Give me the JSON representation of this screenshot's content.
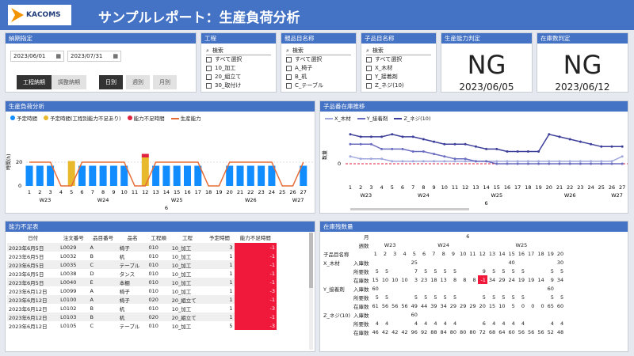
{
  "header": {
    "title": "サンプルレポート：生産負荷分析",
    "logo": "KACOMS"
  },
  "dateFilter": {
    "label": "納期指定",
    "from": "2023/06/01",
    "to": "2023/07/31",
    "buttons": [
      "工程納期",
      "調整納期"
    ],
    "gran": [
      "日別",
      "週別",
      "月別"
    ]
  },
  "slicers": [
    {
      "label": "工程",
      "search": "検索",
      "items": [
        "すべて選択",
        "10_加工",
        "20_組立て",
        "30_取付け"
      ]
    },
    {
      "label": "親品目名称",
      "search": "検索",
      "items": [
        "すべて選択",
        "A_椅子",
        "B_机",
        "C_テーブル"
      ]
    },
    {
      "label": "子品目名称",
      "search": "検索",
      "items": [
        "すべて選択",
        "X_木材",
        "Y_接着剤",
        "Z_ネジ(10)"
      ]
    }
  ],
  "cards": [
    {
      "label": "生産能力判定",
      "value": "NG",
      "date": "2023/06/05"
    },
    {
      "label": "在庫数判定",
      "value": "NG",
      "date": "2023/06/12"
    }
  ],
  "loadChart": {
    "label": "生産負荷分析",
    "legend": [
      "予定時間",
      "予定時間(工程別能力不足あり)",
      "能力不足時間",
      "生産能力"
    ],
    "ylabel": "時間(h)",
    "weeks": [
      "W23",
      "W24",
      "W25",
      "W26",
      "W27"
    ],
    "month": "6"
  },
  "chart_data": [
    {
      "type": "bar",
      "title": "生産負荷分析",
      "x": [
        "1",
        "2",
        "3",
        "4",
        "5",
        "6",
        "7",
        "8",
        "9",
        "10",
        "11",
        "12",
        "13",
        "14",
        "15",
        "16",
        "17",
        "18",
        "19",
        "20",
        "21",
        "22",
        "23",
        "24",
        "25",
        "26",
        "27"
      ],
      "series": [
        {
          "name": "予定時間",
          "values": [
            17,
            17,
            17,
            0,
            0,
            17,
            17,
            17,
            17,
            17,
            0,
            0,
            17,
            17,
            17,
            17,
            17,
            0,
            0,
            17,
            17,
            17,
            17,
            17,
            0,
            0,
            17
          ]
        },
        {
          "name": "予定時間(工程別能力不足あり)",
          "values": [
            0,
            0,
            0,
            0,
            21,
            0,
            0,
            0,
            0,
            0,
            0,
            24,
            0,
            0,
            0,
            0,
            0,
            0,
            0,
            0,
            0,
            0,
            0,
            0,
            0,
            0,
            0
          ]
        },
        {
          "name": "能力不足時間",
          "values": [
            0,
            0,
            0,
            0,
            0,
            0,
            0,
            0,
            0,
            0,
            0,
            3,
            0,
            0,
            0,
            0,
            0,
            0,
            0,
            0,
            0,
            0,
            0,
            0,
            0,
            0,
            0
          ]
        },
        {
          "name": "生産能力",
          "values": [
            20,
            20,
            20,
            0,
            0,
            20,
            20,
            20,
            20,
            20,
            0,
            0,
            20,
            20,
            20,
            20,
            20,
            0,
            0,
            20,
            20,
            20,
            20,
            20,
            0,
            0,
            20
          ]
        }
      ],
      "yticks": [
        "0",
        "20"
      ],
      "ylabel": "時間(h)"
    },
    {
      "type": "line",
      "title": "子品番在庫推移",
      "x": [
        "1",
        "2",
        "3",
        "4",
        "5",
        "6",
        "7",
        "8",
        "9",
        "10",
        "11",
        "12",
        "13",
        "14",
        "15",
        "16",
        "17",
        "18",
        "19",
        "20",
        "21",
        "22",
        "23",
        "24",
        "25",
        "26",
        "27"
      ],
      "series": [
        {
          "name": "X_木材",
          "values": [
            15,
            10,
            10,
            10,
            5,
            5,
            5,
            5,
            5,
            5,
            5,
            5,
            5,
            5,
            5,
            5,
            5,
            5,
            5,
            5,
            5,
            5,
            5,
            5,
            5,
            5,
            15
          ]
        },
        {
          "name": "Y_接着剤",
          "values": [
            40,
            40,
            40,
            30,
            30,
            30,
            25,
            25,
            20,
            15,
            10,
            10,
            5,
            5,
            0,
            0,
            0,
            0,
            0,
            0,
            0,
            0,
            0,
            0,
            0,
            0,
            0
          ]
        },
        {
          "name": "Z_ネジ(10)",
          "values": [
            60,
            55,
            55,
            55,
            60,
            55,
            55,
            50,
            45,
            40,
            40,
            40,
            35,
            30,
            30,
            25,
            25,
            25,
            25,
            60,
            55,
            50,
            45,
            40,
            35,
            35,
            35
          ]
        }
      ],
      "ylabel": "数量",
      "yticks": [
        "0"
      ]
    }
  ],
  "stockChart": {
    "label": "子品番在庫推移",
    "legend": [
      "X_木材",
      "Y_接着剤",
      "Z_ネジ(10)"
    ],
    "weeks": [
      "W23",
      "W24",
      "W25",
      "W26",
      "W27"
    ],
    "month": "6",
    "ylabel": "数量"
  },
  "shortTable": {
    "label": "能力不足表",
    "headers": [
      "日付",
      "注文番号",
      "品目番号",
      "品名",
      "工程順",
      "工程",
      "予定時間",
      "能力不足時間"
    ],
    "rows": [
      [
        "2023年6月5日",
        "L0029",
        "A",
        "椅子",
        "010",
        "10_加工",
        "3",
        "-1"
      ],
      [
        "2023年6月5日",
        "L0032",
        "B",
        "机",
        "010",
        "10_加工",
        "1",
        "-1"
      ],
      [
        "2023年6月5日",
        "L0035",
        "C",
        "テーブル",
        "010",
        "10_加工",
        "1",
        "-1"
      ],
      [
        "2023年6月5日",
        "L0038",
        "D",
        "タンス",
        "010",
        "10_加工",
        "1",
        "-1"
      ],
      [
        "2023年6月5日",
        "L0040",
        "E",
        "本棚",
        "010",
        "10_加工",
        "1",
        "-1"
      ],
      [
        "2023年6月12日",
        "L0099",
        "A",
        "椅子",
        "010",
        "10_加工",
        "1",
        "-3"
      ],
      [
        "2023年6月12日",
        "L0100",
        "A",
        "椅子",
        "020",
        "20_組立て",
        "1",
        "-1"
      ],
      [
        "2023年6月12日",
        "L0102",
        "B",
        "机",
        "010",
        "10_加工",
        "1",
        "-3"
      ],
      [
        "2023年6月12日",
        "L0103",
        "B",
        "机",
        "020",
        "20_組立て",
        "1",
        "-1"
      ],
      [
        "2023年6月12日",
        "L0105",
        "C",
        "テーブル",
        "010",
        "10_加工",
        "5",
        "-3"
      ]
    ]
  },
  "stockTable": {
    "label": "在庫残数量",
    "h1": "月",
    "h2": "週数",
    "h3": "子品目名称",
    "month": "6",
    "weeks": [
      "W23",
      "W24",
      "W25"
    ],
    "days": [
      "1",
      "2",
      "3",
      "4",
      "5",
      "6",
      "7",
      "8",
      "9",
      "10",
      "11",
      "12",
      "13",
      "14",
      "15",
      "16",
      "17",
      "18",
      "19",
      "20"
    ],
    "rows": [
      {
        "item": "X_木材",
        "type": "入庫数",
        "vals": [
          "",
          "",
          "",
          "",
          "25",
          "",
          "",
          "",
          "",
          "",
          "",
          "",
          "",
          "",
          "40",
          "",
          "",
          "",
          "",
          "30"
        ]
      },
      {
        "item": "",
        "type": "所要数",
        "vals": [
          "5",
          "5",
          "",
          "",
          "7",
          "5",
          "5",
          "5",
          "5",
          "",
          "",
          "9",
          "5",
          "5",
          "5",
          "5",
          "",
          "",
          "5",
          "5"
        ]
      },
      {
        "item": "",
        "type": "在庫数",
        "vals": [
          "15",
          "10",
          "10",
          "10",
          "3",
          "23",
          "18",
          "13",
          "8",
          "8",
          "8",
          "-1",
          "34",
          "29",
          "24",
          "19",
          "19",
          "14",
          "9",
          "34"
        ]
      },
      {
        "item": "Y_接着剤",
        "type": "入庫数",
        "vals": [
          "60",
          "",
          "",
          "",
          "",
          "",
          "",
          "",
          "",
          "",
          "",
          "",
          "",
          "",
          "",
          "",
          "",
          "",
          "60",
          ""
        ]
      },
      {
        "item": "",
        "type": "所要数",
        "vals": [
          "5",
          "5",
          "",
          "",
          "5",
          "5",
          "5",
          "5",
          "5",
          "",
          "",
          "5",
          "5",
          "5",
          "5",
          "5",
          "",
          "",
          "5",
          "5"
        ]
      },
      {
        "item": "",
        "type": "在庫数",
        "vals": [
          "61",
          "56",
          "56",
          "56",
          "49",
          "44",
          "39",
          "34",
          "29",
          "29",
          "29",
          "20",
          "15",
          "10",
          "5",
          "0",
          "0",
          "0",
          "65",
          "60"
        ]
      },
      {
        "item": "Z_ネジ(10)",
        "type": "入庫数",
        "vals": [
          "",
          "",
          "",
          "",
          "60",
          "",
          "",
          "",
          "",
          "",
          "",
          "",
          "",
          "",
          "",
          "",
          "",
          "",
          "",
          ""
        ]
      },
      {
        "item": "",
        "type": "所要数",
        "vals": [
          "4",
          "4",
          "",
          "",
          "4",
          "4",
          "4",
          "4",
          "4",
          "",
          "",
          "6",
          "4",
          "4",
          "4",
          "4",
          "",
          "",
          "4",
          "4"
        ]
      },
      {
        "item": "",
        "type": "在庫数",
        "vals": [
          "46",
          "42",
          "42",
          "42",
          "96",
          "92",
          "88",
          "84",
          "80",
          "80",
          "80",
          "72",
          "68",
          "64",
          "60",
          "56",
          "56",
          "56",
          "52",
          "48"
        ]
      }
    ]
  }
}
